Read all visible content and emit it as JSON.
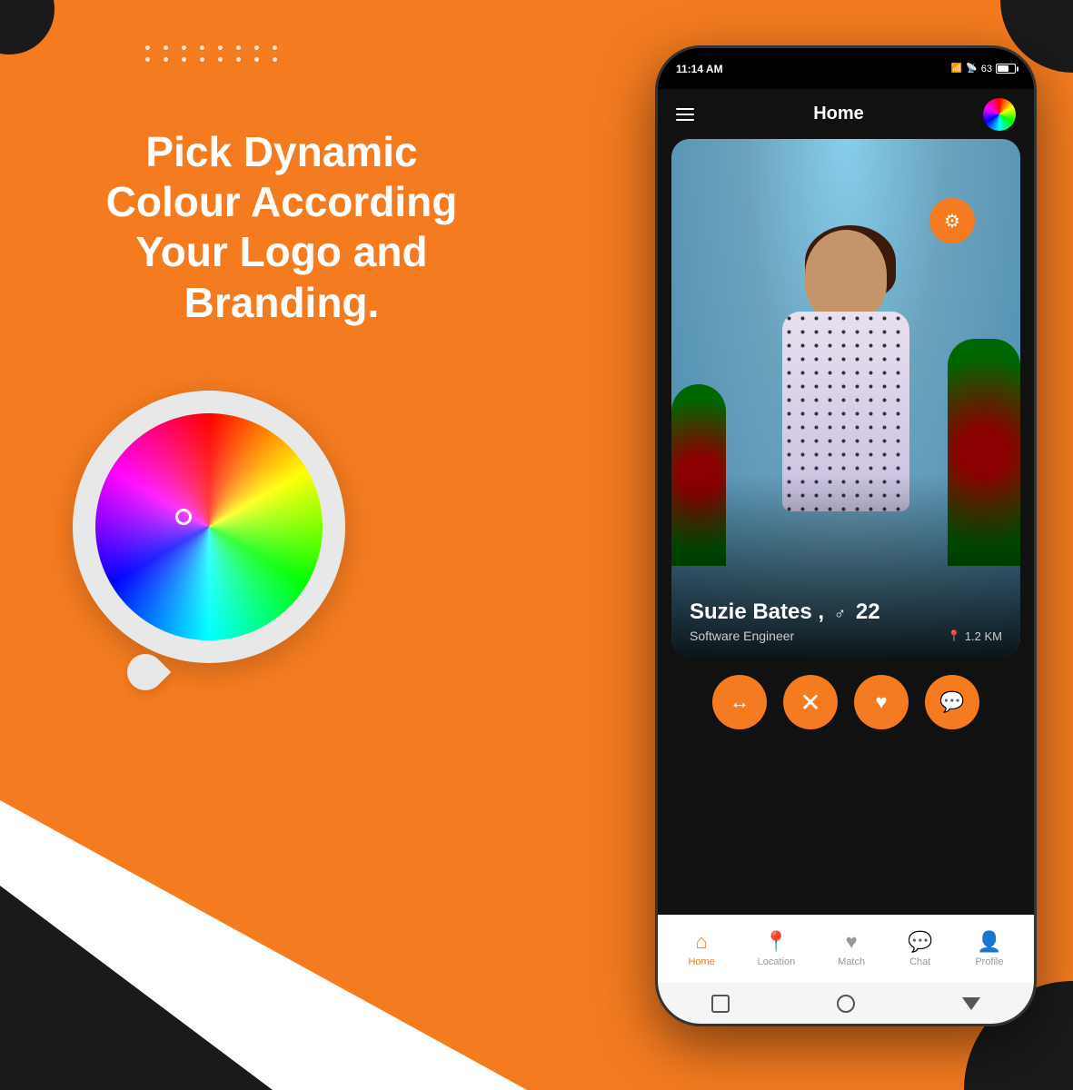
{
  "background": {
    "color": "#F47B20"
  },
  "headline": {
    "line1": "Pick Dynamic",
    "line2": "Colour According",
    "line3": "Your Logo and Branding."
  },
  "dot_pattern": {
    "rows": 2,
    "cols": 8
  },
  "phone": {
    "status_bar": {
      "time": "11:14 AM",
      "battery": "63"
    },
    "header": {
      "title": "Home"
    },
    "profile": {
      "name": "Suzie Bates ,",
      "gender_symbol": "♂",
      "age": "22",
      "job": "Software Engineer",
      "distance": "1.2 KM"
    },
    "action_buttons": {
      "back": "↔",
      "close": "✕",
      "heart": "♥",
      "chat": "💬"
    },
    "bottom_nav": {
      "items": [
        {
          "label": "Home",
          "icon": "⌂",
          "active": true
        },
        {
          "label": "Location",
          "icon": "📍",
          "active": false
        },
        {
          "label": "Match",
          "icon": "♥",
          "active": false
        },
        {
          "label": "Chat",
          "icon": "💬",
          "active": false
        },
        {
          "label": "Profile",
          "icon": "👤",
          "active": false
        }
      ]
    }
  },
  "color_wheel": {
    "selector_label": "color selector"
  }
}
